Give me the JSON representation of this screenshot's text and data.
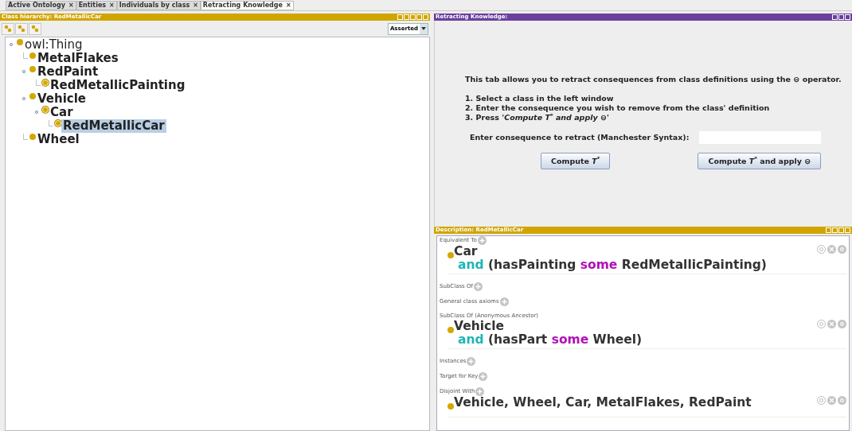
{
  "tabs": [
    {
      "label": "Active Ontology",
      "close": "×",
      "selected": false
    },
    {
      "label": "Entities",
      "close": "×",
      "selected": false
    },
    {
      "label": "Individuals by class",
      "close": "×",
      "selected": false
    },
    {
      "label": "Retracting Knowledge",
      "close": "×",
      "selected": true
    }
  ],
  "class_hierarchy": {
    "title": "Class hierarchy: RedMetallicCar",
    "mode": "Asserted",
    "tree": [
      {
        "label": "owl:Thing",
        "defined": false,
        "selected": false,
        "children": [
          {
            "label": "MetalFlakes",
            "defined": false,
            "selected": false
          },
          {
            "label": "RedPaint",
            "defined": false,
            "selected": false,
            "children": [
              {
                "label": "RedMetallicPainting",
                "defined": true,
                "selected": false
              }
            ]
          },
          {
            "label": "Vehicle",
            "defined": false,
            "selected": false,
            "children": [
              {
                "label": "Car",
                "defined": true,
                "selected": false,
                "children": [
                  {
                    "label": "RedMetallicCar",
                    "defined": true,
                    "selected": true
                  }
                ]
              }
            ]
          },
          {
            "label": "Wheel",
            "defined": false,
            "selected": false
          }
        ]
      }
    ]
  },
  "retracting": {
    "title": "Retracting Knowledge:",
    "intro": "This tab allows you to retract consequences from class definitions using the ⊖ operator.",
    "steps": [
      "1. Select a class in the left window",
      "2. Enter the consequence you wish to remove from the class' definition",
      "3. Press '*Compute T*$^{*}$ *and apply ⊖*'"
    ],
    "field_label": "Enter consequence to retract (Manchester Syntax):",
    "buttons": [
      "Compute *T*$^{*}$",
      "Compute *T*$^{*}$ and apply ⊖"
    ]
  },
  "description": {
    "title": "Description: RedMetallicCar",
    "sections": [
      {
        "label": "Equivalent To",
        "add": true,
        "entries": [
          {
            "lines": [
              [
                {
                  "kind": "name",
                  "text": "Car"
                }
              ],
              [
                {
                  "kind": "and",
                  "text": "and"
                },
                {
                  "kind": "name",
                  "text": " (hasPainting "
                },
                {
                  "kind": "some",
                  "text": "some"
                },
                {
                  "kind": "name",
                  "text": " RedMetallicPainting)"
                }
              ]
            ]
          }
        ]
      },
      {
        "label": "SubClass Of",
        "add": true
      },
      {
        "label": "General class axioms",
        "add": true
      },
      {
        "label": "SubClass Of (Anonymous Ancestor)",
        "add": false,
        "entries": [
          {
            "lines": [
              [
                {
                  "kind": "name",
                  "text": "Vehicle"
                }
              ],
              [
                {
                  "kind": "and",
                  "text": "and"
                },
                {
                  "kind": "name",
                  "text": " (hasPart "
                },
                {
                  "kind": "some",
                  "text": "some"
                },
                {
                  "kind": "name",
                  "text": " Wheel)"
                }
              ]
            ]
          }
        ]
      },
      {
        "label": "Instances",
        "add": true
      },
      {
        "label": "Target for Key",
        "add": true
      },
      {
        "label": "Disjoint With",
        "add": true,
        "entries": [
          {
            "lines": [
              [
                {
                  "kind": "name",
                  "text": "Vehicle, Wheel, Car, MetalFlakes, RedPaint"
                }
              ]
            ]
          }
        ]
      }
    ]
  }
}
